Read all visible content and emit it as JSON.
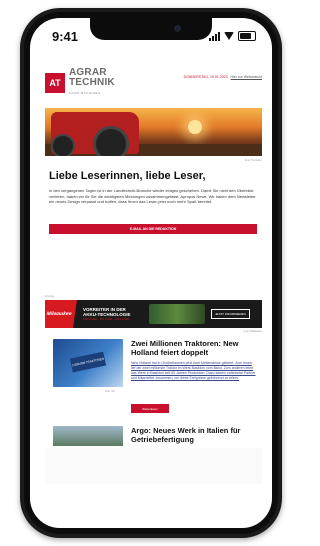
{
  "status_bar": {
    "time": "9:41"
  },
  "newsletter": {
    "logo": {
      "mark": "AT",
      "line1": "AGRAR",
      "line2": "TECHNIK",
      "tagline": "FARM MACHINES"
    },
    "topline": {
      "date": "DONNERSTAG, 19.01.2023",
      "web_link": "Hier zur Webansicht"
    },
    "hero_caption": "Foto: Hersteller",
    "greeting": "Liebe Leserinnen, liebe Leser,",
    "intro_text": "in den vergangenen Tagen ist in der Landtechnik-Branche wieder einiges geschehen. Damit Sie nicht den Überblick verlieren, haben wir für Sie die wichtigsten Meldungen zusammengefasst. Apropos News: Wir haben dem Newsletter ein neues Design verpasst und hoffen, dass Ihnen das Lesen jetzt noch mehr Spaß bereitet.",
    "cta_label": "E-MAIL AN DIE REDAKTION",
    "ad": {
      "label": "Anzeige",
      "brand": "Milwaukee",
      "headline_1": "VORREITER IN DER",
      "headline_2": "AKKU-TECHNOLOGIE",
      "subline": "M18 FUEL · MX FUEL · M12 FUEL",
      "cta": "JETZT INFORMIEREN",
      "caption": "Foto: Milwaukee"
    },
    "articles": [
      {
        "title": "Zwei Millionen Traktoren: New Holland feiert doppelt",
        "image_text": "2.000.000 TRAKTOREN",
        "caption": "Foto: NH",
        "text": "New Holland hat in Großbritannien jetzt zwei Meilensteine gefeiert. Zum einen lief der zwei millionste Traktor im Werk Basildon vom Band. Zum anderen feiert das Werk in Basildon seit 60 Jahren Produktion. Dazu kamen zahlreiche Partner und Mitarbeiter zusammen, um diese Ereignisse gebührend zu feiern.",
        "button": "Weiterlesen"
      },
      {
        "title": "Argo: Neues Werk in Italien für Getriebefertigung"
      }
    ]
  }
}
